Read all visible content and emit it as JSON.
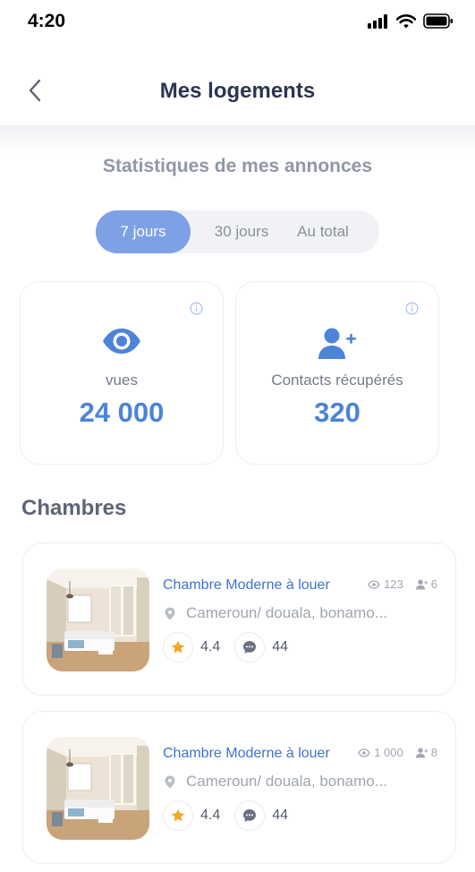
{
  "status_bar": {
    "time": "4:20"
  },
  "header": {
    "title": "Mes logements"
  },
  "stats": {
    "subtitle": "Statistiques de mes annonces",
    "tabs": [
      {
        "label": "7 jours",
        "active": true
      },
      {
        "label": "30 jours",
        "active": false
      },
      {
        "label": "Au total",
        "active": false
      }
    ],
    "cards": [
      {
        "icon": "eye-icon",
        "label": "vues",
        "value": "24 000"
      },
      {
        "icon": "user-plus-icon",
        "label": "Contacts récupérés",
        "value": "320"
      }
    ]
  },
  "rooms": {
    "heading": "Chambres",
    "items": [
      {
        "title": "Chambre Moderne à louer",
        "views": "123",
        "contacts": "6",
        "location": "Cameroun/ douala, bonamo...",
        "rating": "4.4",
        "comments": "44"
      },
      {
        "title": "Chambre Moderne à louer",
        "views": "1 000",
        "contacts": "8",
        "location": "Cameroun/ douala, bonamo...",
        "rating": "4.4",
        "comments": "44"
      }
    ]
  },
  "colors": {
    "accent": "#4d83d8",
    "tab_active": "#7ea1e6",
    "star": "#f5a623",
    "title_dark": "#2b3550"
  }
}
